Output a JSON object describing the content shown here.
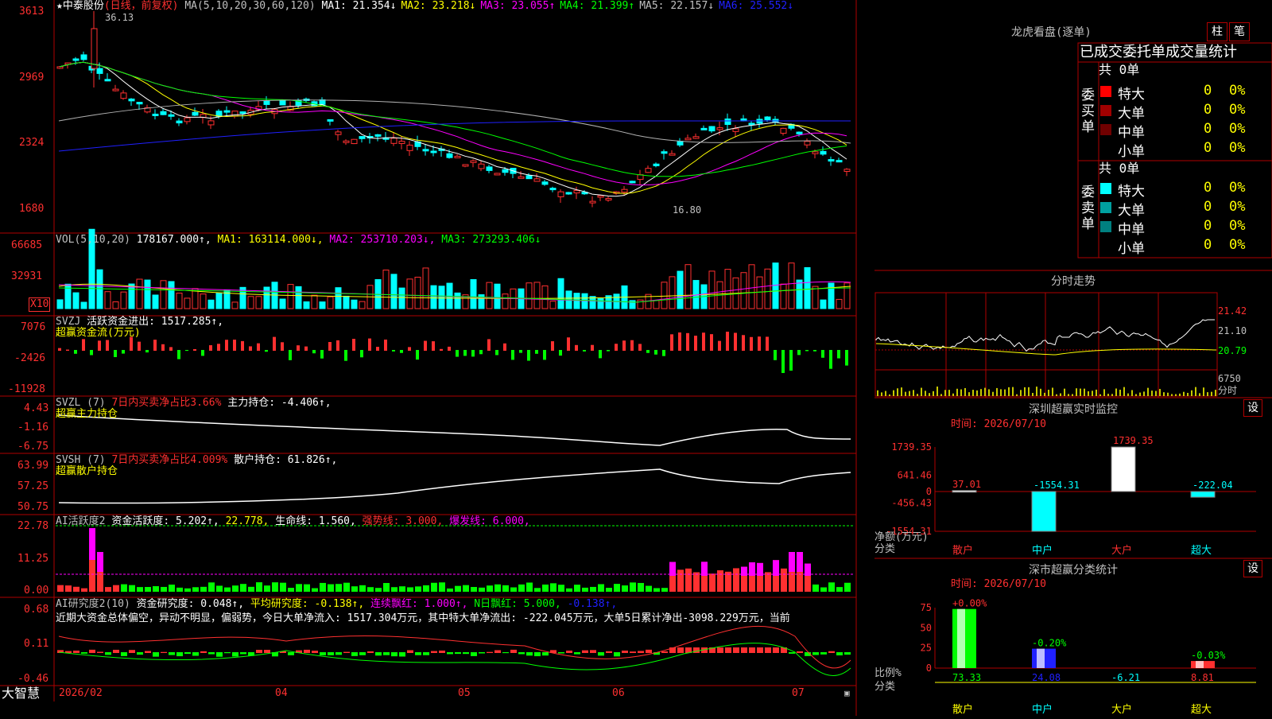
{
  "app": {
    "name": "大智慧"
  },
  "stock": {
    "title": "★中泰股份",
    "period": "(日线，前复权)"
  },
  "price_panel": {
    "ma_label": "MA(5,10,20,30,60,120)",
    "ma": [
      {
        "label": "MA1:",
        "value": "21.354",
        "arrow": "↓",
        "color": "#ffffff"
      },
      {
        "label": "MA2:",
        "value": "23.218",
        "arrow": "↓",
        "color": "#ffff00"
      },
      {
        "label": "MA3:",
        "value": "23.055",
        "arrow": "↑",
        "color": "#ff00ff"
      },
      {
        "label": "MA4:",
        "value": "21.399",
        "arrow": "↑",
        "color": "#00ff00"
      },
      {
        "label": "MA5:",
        "value": "22.157",
        "arrow": "↓",
        "color": "#c0c0c0"
      },
      {
        "label": "MA6:",
        "value": "25.552",
        "arrow": "↓",
        "color": "#2020ff"
      }
    ],
    "y_ticks": [
      "3613",
      "2969",
      "2324",
      "1680"
    ],
    "high_label": "36.13",
    "low_label": "16.80"
  },
  "vol_panel": {
    "label": "VOL(5,10,20)",
    "value": "178167.000↑,",
    "ma1": "MA1: 163114.000↓,",
    "ma2": "MA2: 253710.203↓,",
    "ma3": "MA3: 273293.406↓",
    "y_ticks": [
      "66685",
      "32931"
    ],
    "unit": "X10"
  },
  "svzj_panel": {
    "label": "SVZJ",
    "desc": "活跃资金进出: 1517.285↑,",
    "sub": "超赢资金流(万元)",
    "y_ticks": [
      "7076",
      "-2426",
      "-11928"
    ]
  },
  "svzl_panel": {
    "label": "SVZL (7)",
    "desc": "7日内买卖净占比3.66%",
    "desc2": "主力持仓: -4.406↑,",
    "sub": "超赢主力持仓",
    "y_ticks": [
      "4.43",
      "-1.16",
      "-6.75"
    ]
  },
  "svsh_panel": {
    "label": "SVSH (7)",
    "desc": "7日内买卖净占比4.009%",
    "desc2": "散户持仓: 61.826↑,",
    "sub": "超赢散户持仓",
    "y_ticks": [
      "63.99",
      "57.25",
      "50.75"
    ]
  },
  "ai_active_panel": {
    "label": "AI活跃度2",
    "desc": "资金活跃度: 5.202↑,",
    "v2": "22.778,",
    "v3": "生命线: 1.560,",
    "v4": "强势线: 3.000,",
    "v5": "爆发线: 6.000,",
    "y_ticks": [
      "22.78",
      "11.25",
      "0.00"
    ]
  },
  "ai_research_panel": {
    "label": "AI研究度2(10)",
    "desc": "资金研究度: 0.048↑,",
    "v2": "平均研究度: -0.138↑,",
    "v3": "连续飘红: 1.000↑,",
    "v4": "N日飘红: 5.000,",
    "v5": "-0.138↑,",
    "comment": "近期大资金总体偏空，异动不明显，偏弱势，今日大单净流入: 1517.304万元，其中特大单净流出: -222.045万元，大单5日累计净出-3098.229万元，当前",
    "y_ticks": [
      "0.68",
      "0.11",
      "-0.46"
    ]
  },
  "x_axis": {
    "labels": [
      "2026/02",
      "04",
      "05",
      "06",
      "07"
    ]
  },
  "longhu": {
    "title": "龙虎看盘(逐单)",
    "btn1": "柱",
    "btn2": "笔",
    "header": "已成交委托单成交量统计",
    "buy": {
      "side_label": "委买单",
      "total": "共 0单",
      "rows": [
        {
          "name": "特大",
          "count": "0",
          "pct": "0%",
          "color": "#ff0000"
        },
        {
          "name": "大单",
          "count": "0",
          "pct": "0%",
          "color": "#a00000"
        },
        {
          "name": "中单",
          "count": "0",
          "pct": "0%",
          "color": "#700000"
        },
        {
          "name": "小单",
          "count": "0",
          "pct": "0%",
          "color": ""
        }
      ]
    },
    "sell": {
      "side_label": "委卖单",
      "total": "共 0单",
      "rows": [
        {
          "name": "特大",
          "count": "0",
          "pct": "0%",
          "color": "#00ffff"
        },
        {
          "name": "大单",
          "count": "0",
          "pct": "0%",
          "color": "#00a0a0"
        },
        {
          "name": "中单",
          "count": "0",
          "pct": "0%",
          "color": "#008080"
        },
        {
          "name": "小单",
          "count": "0",
          "pct": "0%",
          "color": ""
        }
      ]
    }
  },
  "intraday": {
    "title": "分时走势",
    "y_labels": [
      "21.42",
      "21.10",
      "20.79"
    ],
    "vol_label": "6750",
    "unit": "分时"
  },
  "sz_monitor": {
    "title": "深圳超赢实时监控",
    "btn": "设",
    "time": "时间: 2026/07/10",
    "y_ticks": [
      "1739.35",
      "641.46",
      "0",
      "-456.43",
      "-1554.31"
    ],
    "unit1": "净额(万元)",
    "unit2": "分类",
    "categories": [
      "散户",
      "中户",
      "大户",
      "超大"
    ],
    "values": [
      37.01,
      -1554.31,
      1739.35,
      -222.04
    ],
    "value_labels": [
      "37.01",
      "-1554.31",
      "1739.35",
      "-222.04"
    ]
  },
  "sz_category": {
    "title": "深市超赢分类统计",
    "btn": "设",
    "time": "时间: 2026/07/10",
    "y_ticks": [
      "75",
      "50",
      "25",
      "0"
    ],
    "unit1": "比例%",
    "unit2": "分类",
    "categories": [
      "散户",
      "中户",
      "大户",
      "超大"
    ],
    "values": [
      73.33,
      24.08,
      -6.21,
      8.81
    ],
    "value_labels": [
      "73.33",
      "24.08",
      "-6.21",
      "8.81"
    ],
    "change_labels": [
      "+0.00%",
      "-0.20%",
      "",
      "-0.03%"
    ]
  },
  "chart_data": [
    {
      "type": "bar",
      "title": "深圳超赢实时监控",
      "ylabel": "净额(万元)",
      "categories": [
        "散户",
        "中户",
        "大户",
        "超大"
      ],
      "values": [
        37.01,
        -1554.31,
        1739.35,
        -222.04
      ],
      "ylim": [
        -1554.31,
        1739.35
      ]
    },
    {
      "type": "bar",
      "title": "深市超赢分类统计",
      "ylabel": "比例%",
      "categories": [
        "散户",
        "中户",
        "大户",
        "超大"
      ],
      "values": [
        73.33,
        24.08,
        -6.21,
        8.81
      ],
      "ylim": [
        0,
        75
      ]
    }
  ]
}
